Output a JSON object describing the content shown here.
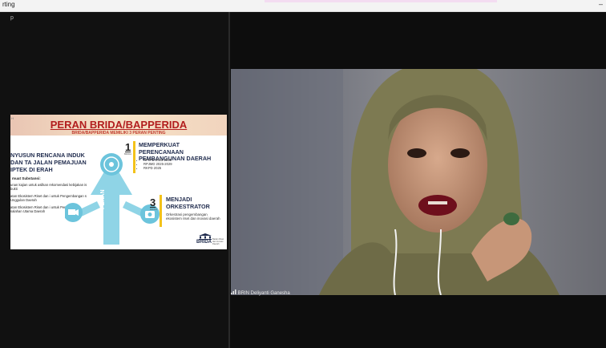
{
  "window": {
    "title": "rting",
    "minimize_label": "–"
  },
  "left_pane": {
    "label": "p"
  },
  "slide": {
    "corner": "H",
    "title": "PERAN BRIDA/BAPPERIDA",
    "subtitle": "BRIDA/BAPPERIDA MEMILIKI 3 PERAN PENTING",
    "left_heading": "NYUSUN RENCANA INDUK DAN TA JALAN PEMAJUAN IPTEK DI ERAH",
    "muatan": "muat Substansi:",
    "bullets": [
      "unan kajian untuk asilkan rekomendasi kebijakan is bukti",
      "atan Ekosistem Riset dan i untuk Pengembangan s Unggulan Daerah",
      "atan Ekosistem Riset dan i untuk Penyelesaian salahan Utama Daerah"
    ],
    "peran_label": "PERAN",
    "role1": {
      "number": "1",
      "number_sub": "BRIDA",
      "heading": "MEMPERKUAT PERENCANAAN PEMBANGUNAN DAERAH",
      "items": [
        "RPJPD 2025-2045",
        "RPJMD 2025-2029",
        "RKPD 2025"
      ]
    },
    "role3": {
      "number": "3",
      "number_sub": "BRIDA",
      "heading": "MENJADI ORKESTRATOR",
      "description": "Orkestrasi pengembangan ekosistem riset dan inovasi daerah"
    },
    "logo": {
      "text": "BRIDA",
      "sub": "Badan Riset dan Inovasi Daerah"
    }
  },
  "video": {
    "participant_name": "BRIN Deliyanti Ganesha"
  }
}
